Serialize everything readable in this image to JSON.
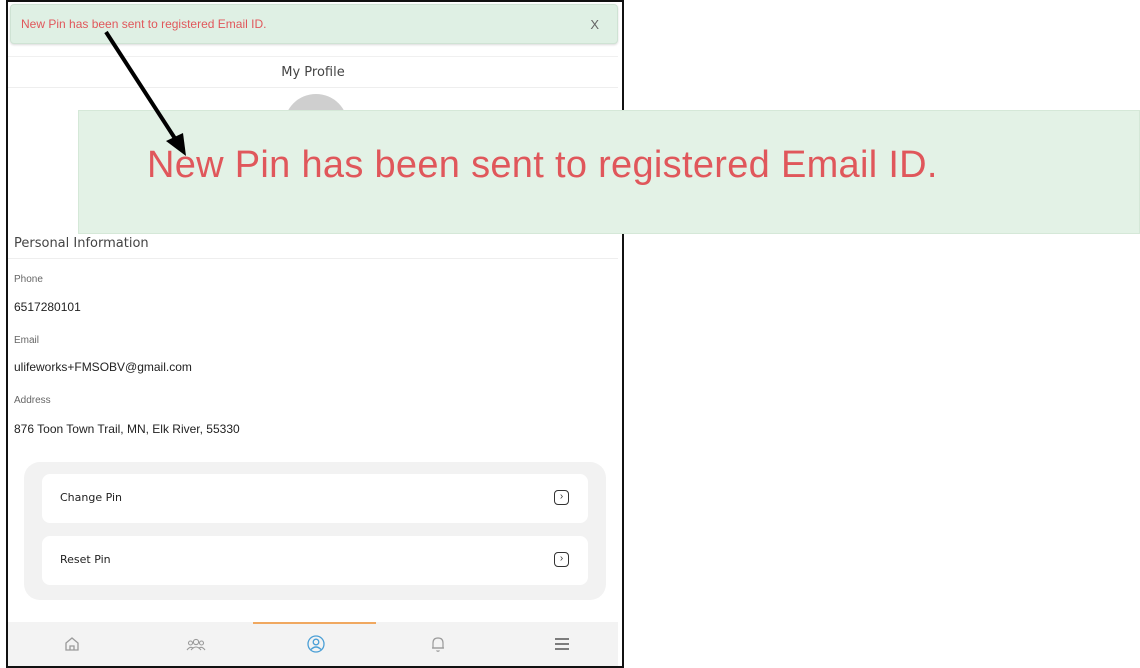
{
  "toast": {
    "message": "New Pin has been sent to registered Email ID.",
    "close": "X"
  },
  "header": {
    "title": "My Profile"
  },
  "section": {
    "title": "Personal Information"
  },
  "fields": {
    "phone": {
      "label": "Phone",
      "value": "6517280101"
    },
    "email": {
      "label": "Email",
      "value": "ulifeworks+FMSOBV@gmail.com"
    },
    "address": {
      "label": "Address",
      "value": "876 Toon Town Trail, MN, Elk River, 55330"
    }
  },
  "actions": [
    {
      "label": "Change Pin",
      "icon": "chevron-right-square-icon"
    },
    {
      "label": "Reset Pin",
      "icon": "chevron-right-square-icon"
    }
  ],
  "bottom_nav": [
    {
      "icon": "home-icon"
    },
    {
      "icon": "group-icon"
    },
    {
      "icon": "profile-icon",
      "active": true
    },
    {
      "icon": "bell-icon"
    },
    {
      "icon": "menu-icon"
    }
  ],
  "annotation": {
    "zoomed_message": "New Pin has been sent to registered Email ID."
  },
  "colors": {
    "toast_bg": "#dff0e4",
    "toast_text": "#e0575b",
    "active_indicator": "#f0a860",
    "nav_icon": "#9a9a9a",
    "active_icon": "#4a9fd6"
  }
}
